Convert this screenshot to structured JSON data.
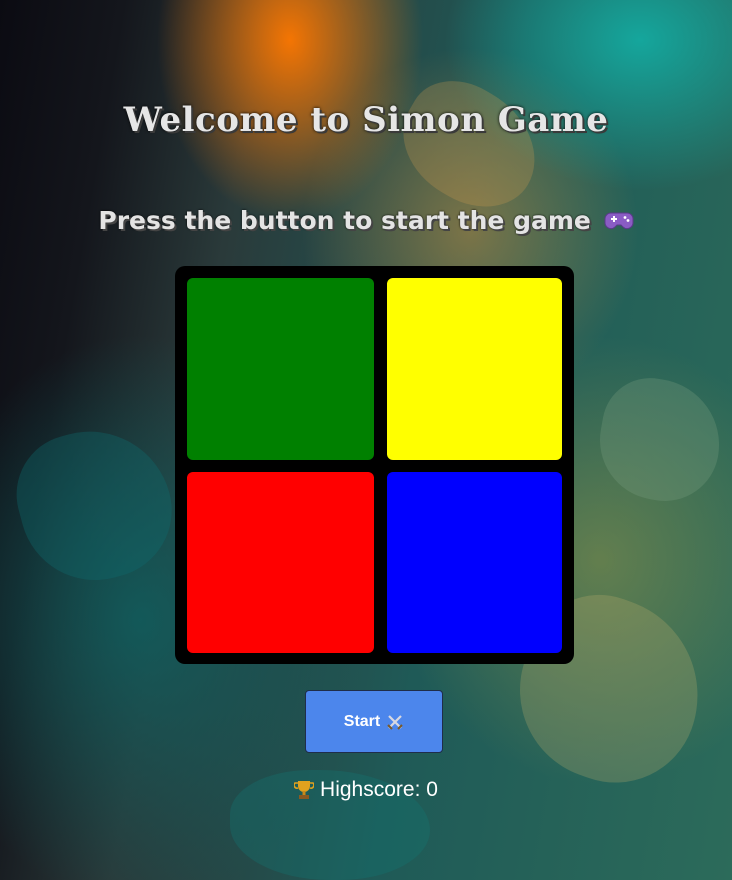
{
  "header": {
    "title": "Welcome to Simon Game",
    "subtitle": "Press the button to start the game",
    "subtitle_icon": "gamepad-icon"
  },
  "board": {
    "pads": [
      {
        "color_name": "green",
        "color": "#008000"
      },
      {
        "color_name": "yellow",
        "color": "#ffff00"
      },
      {
        "color_name": "red",
        "color": "#ff0000"
      },
      {
        "color_name": "blue",
        "color": "#0000ff"
      }
    ]
  },
  "controls": {
    "start_label": "Start",
    "start_icon": "crossed-swords-icon",
    "start_color": "#4c86ec"
  },
  "score": {
    "label": "Highscore: 0",
    "icon": "trophy-icon"
  }
}
